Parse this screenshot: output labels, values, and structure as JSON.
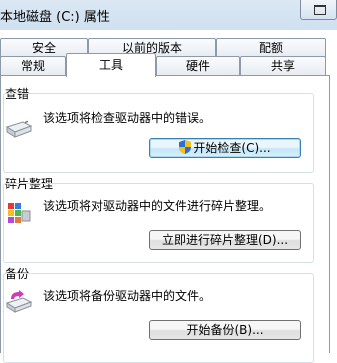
{
  "window": {
    "title": "本地磁盘 (C:) 属性"
  },
  "tabs": {
    "row1": [
      "安全",
      "以前的版本",
      "配额"
    ],
    "row2": [
      "常规",
      "工具",
      "硬件",
      "共享"
    ],
    "selected": "工具"
  },
  "error_check": {
    "label": "查错",
    "description": "该选项将检查驱动器中的错误。",
    "button": "开始检查(C)...",
    "icon": "drive-icon"
  },
  "defrag": {
    "label": "碎片整理",
    "description": "该选项将对驱动器中的文件进行碎片整理。",
    "button": "立即进行碎片整理(D)...",
    "icon": "defrag-icon"
  },
  "backup": {
    "label": "备份",
    "description": "该选项将备份驱动器中的文件。",
    "button": "开始备份(B)...",
    "icon": "backup-icon"
  },
  "colors": {
    "accent": "#3c7fb1",
    "titlebar": "#cfe0f0",
    "group_border": "#d5dfe5"
  }
}
